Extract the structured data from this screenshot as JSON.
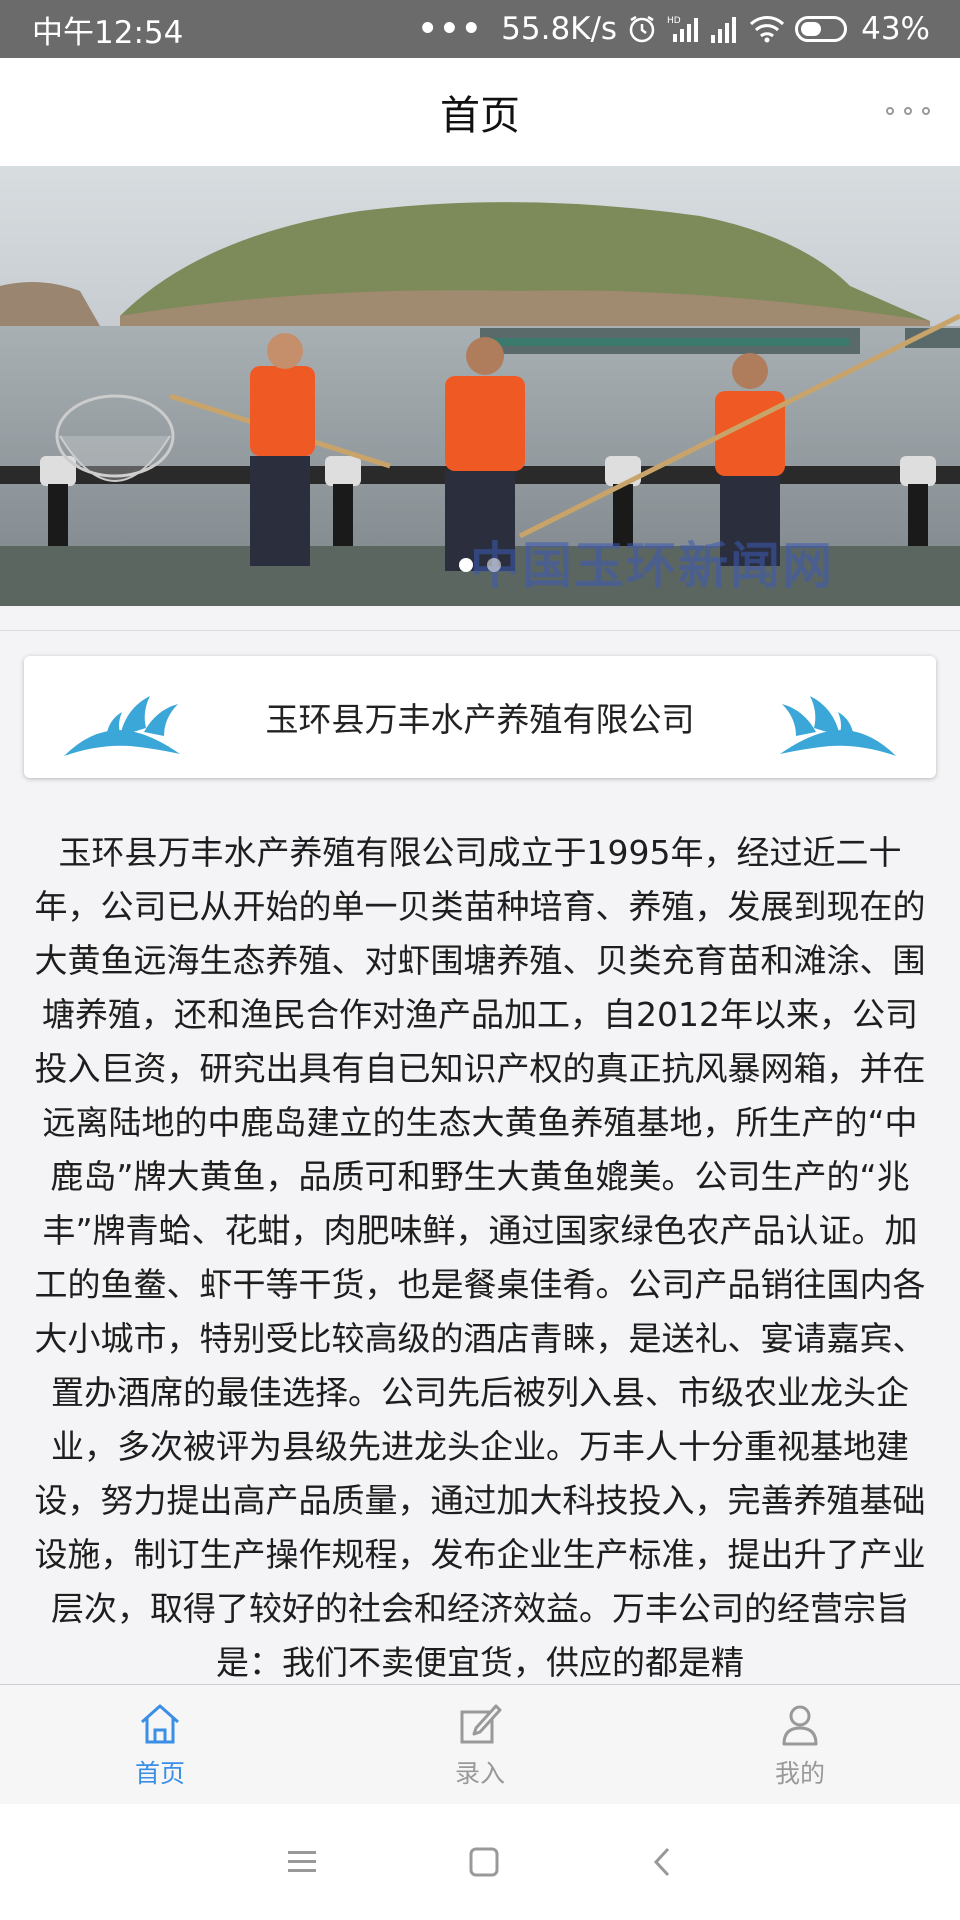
{
  "status_bar": {
    "time": "中午12:54",
    "dots": "•••",
    "network_speed": "55.8K/s",
    "battery": "43%",
    "icons": [
      "alarm-icon",
      "hd-signal-icon",
      "signal-icon",
      "wifi-icon",
      "battery-icon"
    ]
  },
  "header": {
    "title": "首页",
    "menu_icon": "more-icon"
  },
  "banner": {
    "watermark": "中国玉环新闻网",
    "slide_count": 2,
    "active_slide": 1
  },
  "company": {
    "name": "玉环县万丰水产养殖有限公司",
    "decoration_icon": "wave-icon",
    "accent_color": "#3aa7d8"
  },
  "description": "玉环县万丰水产养殖有限公司成立于1995年，经过近二十年，公司已从开始的单一贝类苗种培育、养殖，发展到现在的大黄鱼远海生态养殖、对虾围塘养殖、贝类充育苗和滩涂、围塘养殖，还和渔民合作对渔产品加工，自2012年以来，公司投入巨资，研究出具有自已知识产权的真正抗风暴网箱，并在远离陆地的中鹿岛建立的生态大黄鱼养殖基地，所生产的“中鹿岛”牌大黄鱼，品质可和野生大黄鱼媲美。公司生产的“兆丰”牌青蛤、花蚶，肉肥味鲜，通过国家绿色农产品认证。加工的鱼鲞、虾干等干货，也是餐桌佳肴。公司产品销往国内各大小城市，特别受比较高级的酒店青睐，是送礼、宴请嘉宾、置办酒席的最佳选择。公司先后被列入县、市级农业龙头企业，多次被评为县级先进龙头企业。万丰人十分重视基地建设，努力提出高产品质量，通过加大科技投入，完善养殖基础设施，制订生产操作规程，发布企业生产标准，提出升了产业层次，取得了较好的社会和经济效益。万丰公司的经营宗旨是：我们不卖便宜货，供应的都是精",
  "tabs": [
    {
      "label": "首页",
      "icon": "home-icon",
      "active": true
    },
    {
      "label": "录入",
      "icon": "edit-icon",
      "active": false
    },
    {
      "label": "我的",
      "icon": "user-icon",
      "active": false
    }
  ],
  "colors": {
    "active_tab": "#3a8ee6",
    "inactive_tab": "#999999",
    "status_bar": "#6b6b6b"
  },
  "system_nav": [
    "menu-icon",
    "home-square-icon",
    "back-icon"
  ]
}
